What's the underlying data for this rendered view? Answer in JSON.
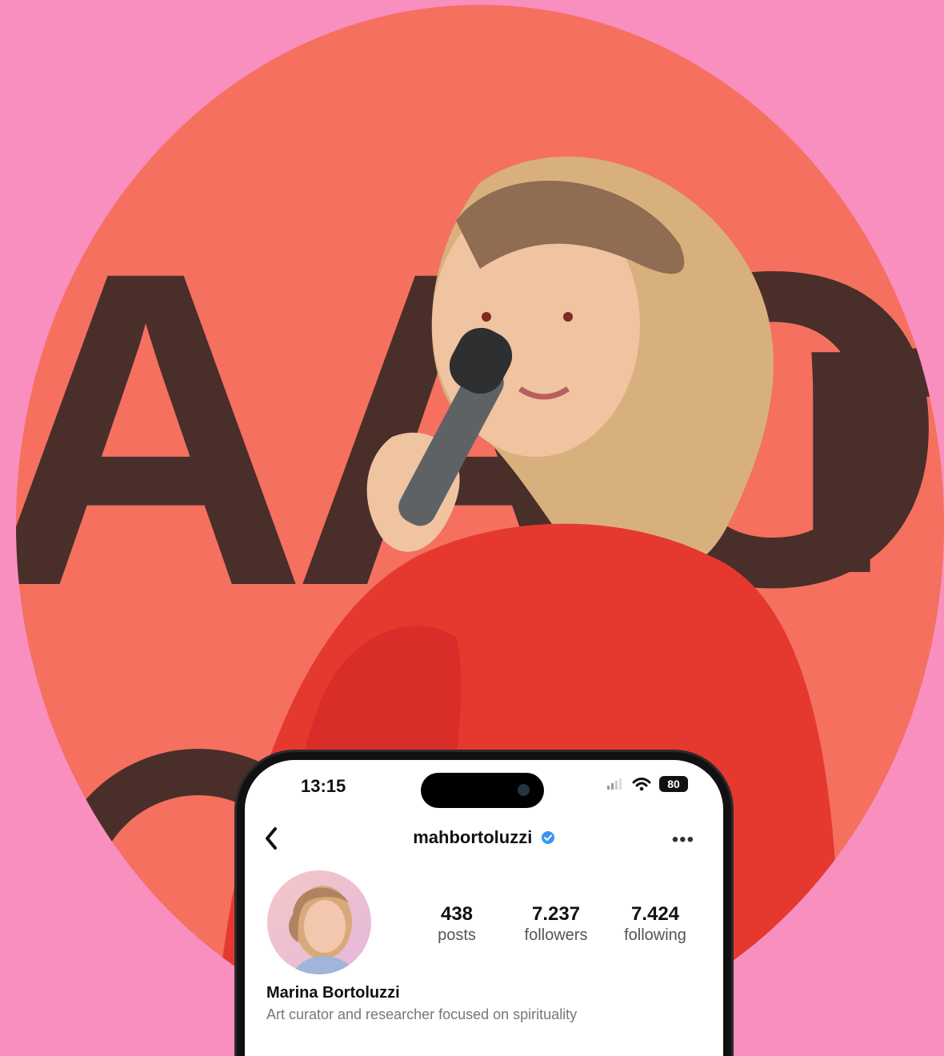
{
  "profile": {
    "time": "13:15",
    "battery": "80",
    "username": "mahbortoluzzi",
    "full_name": "Marina Bortoluzzi",
    "bio_partial": "Art curator and researcher focused on spirituality",
    "stats": [
      {
        "value": "438",
        "label": "posts"
      },
      {
        "value": "7.237",
        "label": "followers"
      },
      {
        "value": "7.424",
        "label": "following"
      }
    ]
  },
  "icons": {
    "back": "chevron-left-icon",
    "verified": "verified-badge-icon",
    "more": "more-icon",
    "wifi": "wifi-icon",
    "signal": "signal-icon",
    "battery": "battery-icon"
  },
  "colors": {
    "background": "#f98fbf",
    "stage": "#f5705f",
    "dress": "#e5392f",
    "verified": "#3897f0"
  }
}
